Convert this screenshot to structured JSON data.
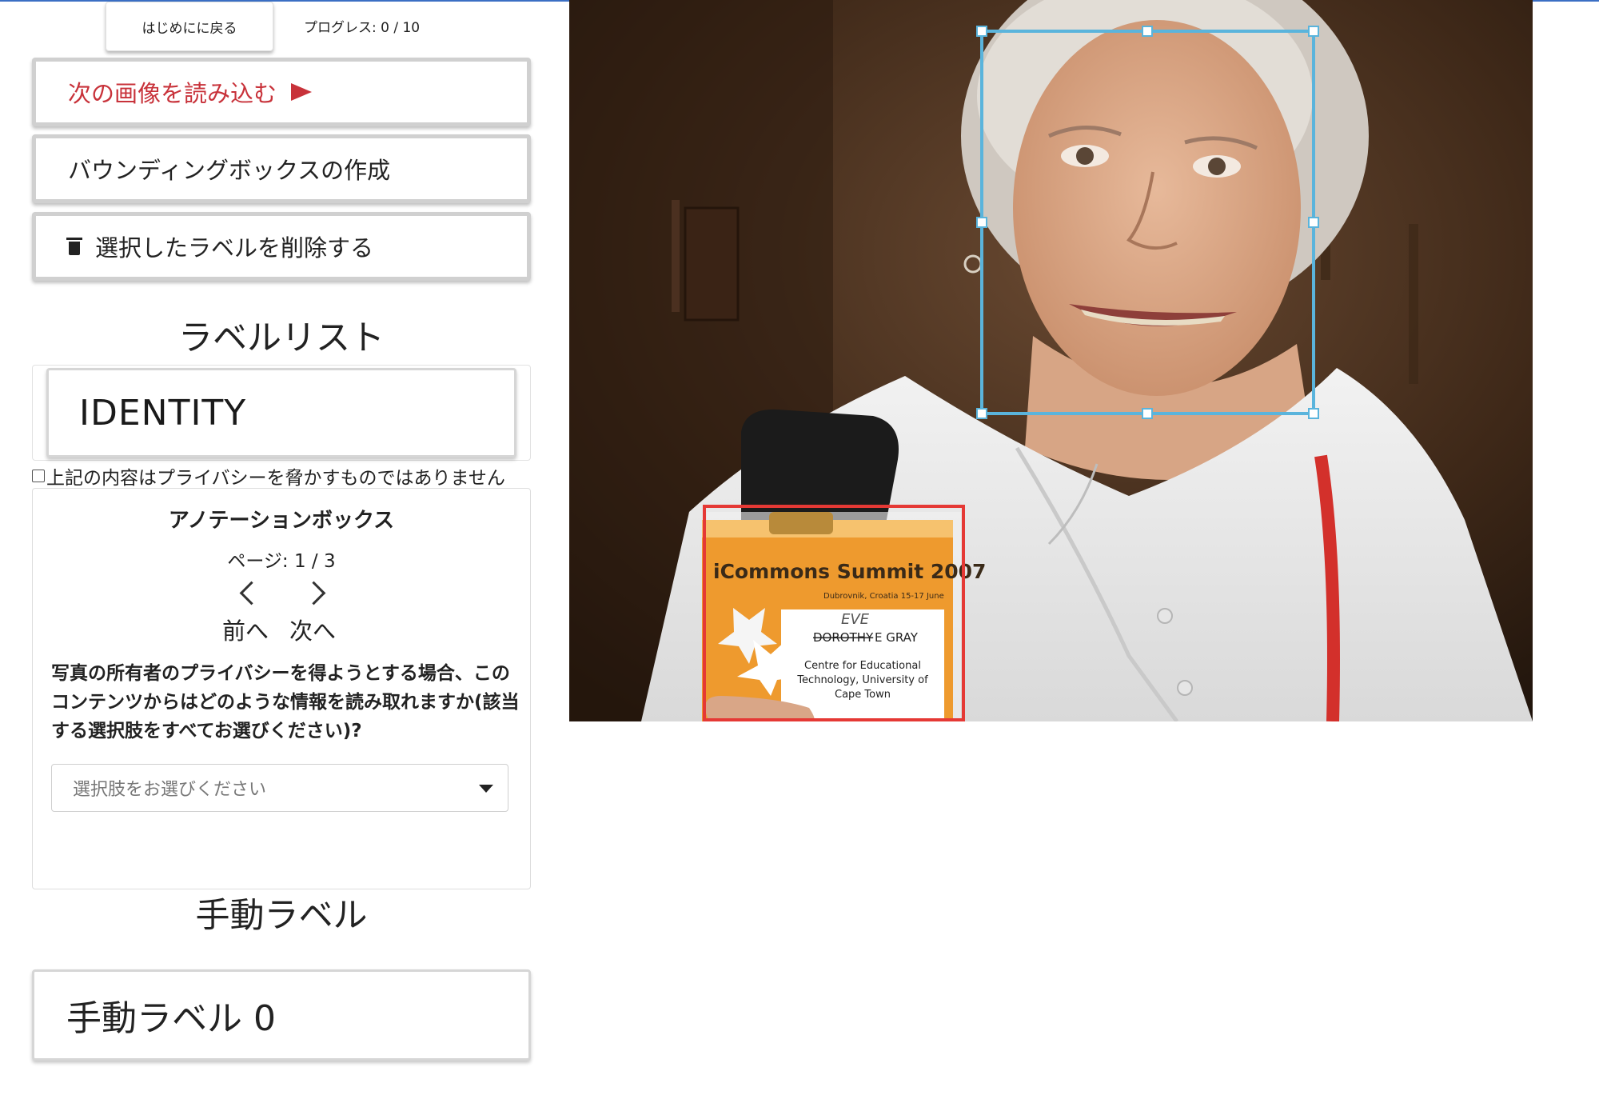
{
  "topbar": {
    "back_label": "はじめにに戻る",
    "progress_label": "プログレス: 0 / 10"
  },
  "actions": {
    "next_image": "次の画像を読み込む",
    "create_bbox": "バウンディングボックスの作成",
    "delete_label": "選択したラベルを削除する"
  },
  "label_list": {
    "title": "ラベルリスト",
    "items": [
      "IDENTITY"
    ],
    "privacy_check": "上記の内容はプライバシーを脅かすものではありません",
    "privacy_checked": false
  },
  "annotation": {
    "title": "アノテーションボックス",
    "page": "ページ: 1 / 3",
    "prev": "前へ",
    "next": "次へ",
    "question": "写真の所有者のプライバシーを得ようとする場合、このコンテンツからはどのような情報を読み取れますか(該当する選択肢をすべてお選びください)?",
    "select_placeholder": "選択肢をお選びください"
  },
  "manual": {
    "title": "手動ラベル",
    "items": [
      "手動ラベル 0"
    ]
  },
  "photo": {
    "badge_title": "iCommons Summit 2007",
    "badge_location": "Dubrovnik, Croatia  15-17 June",
    "badge_handwritten": "EVE",
    "badge_name_struck": "DOROTHY",
    "badge_name": "E GRAY",
    "badge_org_1": "Centre for Educational",
    "badge_org_2": "Technology, University of",
    "badge_org_3": "Cape Town",
    "selected_box_color": "#5ab4dc",
    "label_box_color": "#e53935"
  },
  "colors": {
    "accent_red": "#c8323a",
    "top_line": "#3b6fc4"
  }
}
